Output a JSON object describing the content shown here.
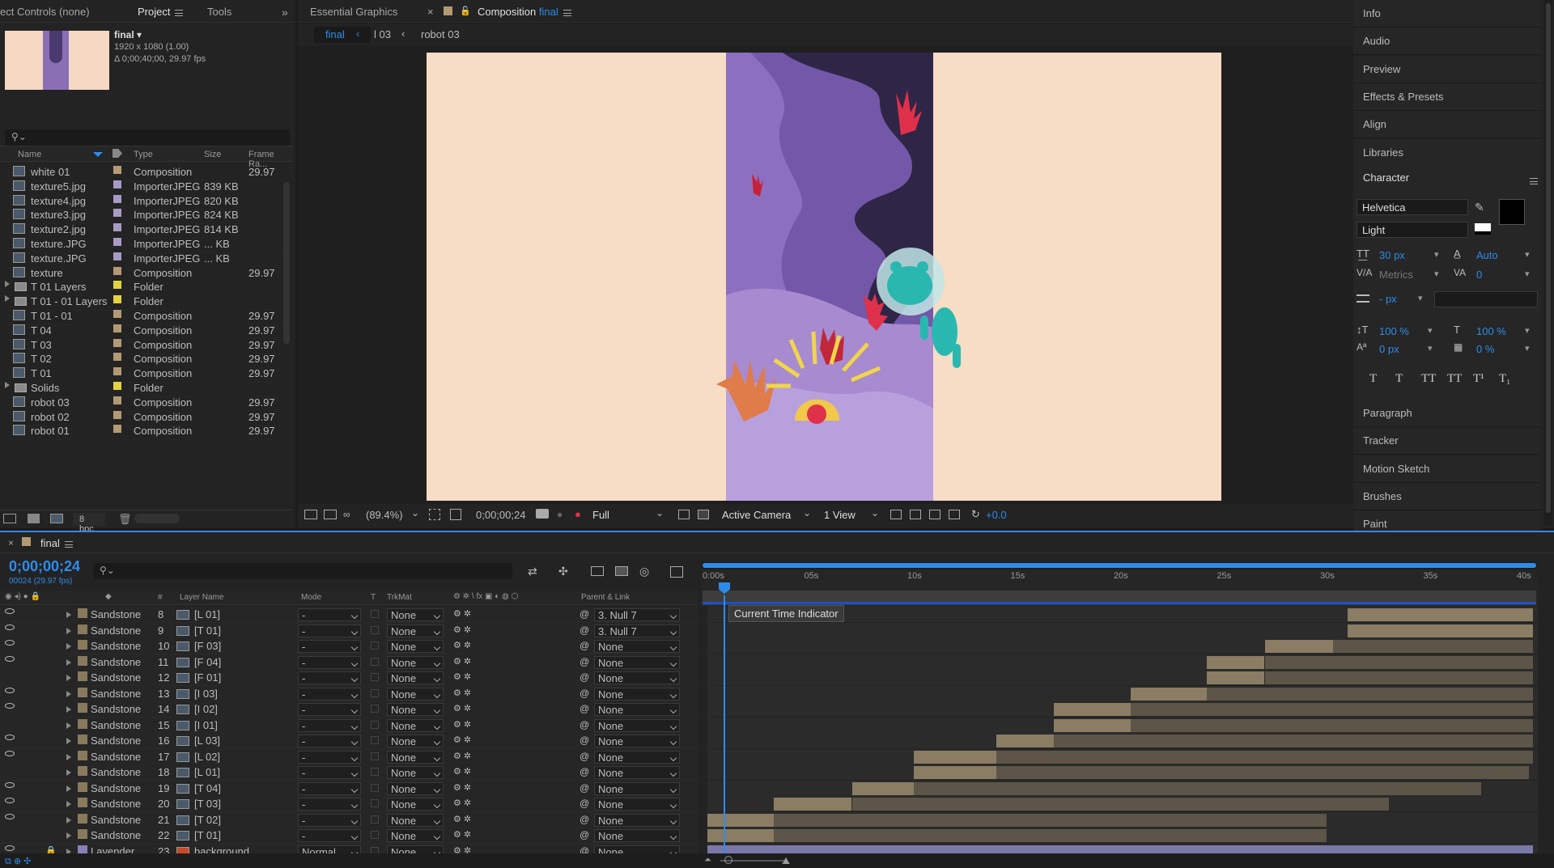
{
  "project_panel": {
    "tabs": [
      "ect Controls (none)",
      "Project",
      "Tools"
    ],
    "selected_name": "final",
    "selected_info": [
      "1920 x 1080 (1.00)",
      "Δ 0;00;40;00, 29.97 fps"
    ],
    "columns": [
      "Name",
      "Type",
      "Size",
      "Frame Ra..."
    ],
    "items": [
      {
        "name": "white 01",
        "type": "Composition",
        "size": "",
        "fps": "29.97",
        "kind": "comp",
        "label": "#b39a74"
      },
      {
        "name": "texture5.jpg",
        "type": "ImporterJPEG",
        "size": "839 KB",
        "fps": "",
        "kind": "file",
        "label": "#a89ac4"
      },
      {
        "name": "texture4.jpg",
        "type": "ImporterJPEG",
        "size": "820 KB",
        "fps": "",
        "kind": "file",
        "label": "#a89ac4"
      },
      {
        "name": "texture3.jpg",
        "type": "ImporterJPEG",
        "size": "824 KB",
        "fps": "",
        "kind": "file",
        "label": "#a89ac4"
      },
      {
        "name": "texture2.jpg",
        "type": "ImporterJPEG",
        "size": "814 KB",
        "fps": "",
        "kind": "file",
        "label": "#a89ac4"
      },
      {
        "name": "texture.JPG",
        "type": "ImporterJPEG",
        "size": "... KB",
        "fps": "",
        "kind": "file",
        "label": "#a89ac4"
      },
      {
        "name": "texture.JPG",
        "type": "ImporterJPEG",
        "size": "... KB",
        "fps": "",
        "kind": "file",
        "label": "#a89ac4"
      },
      {
        "name": "texture",
        "type": "Composition",
        "size": "",
        "fps": "29.97",
        "kind": "comp",
        "label": "#b39a74"
      },
      {
        "name": "T 01 Layers",
        "type": "Folder",
        "size": "",
        "fps": "",
        "kind": "folder",
        "label": "#e5d33d"
      },
      {
        "name": "T 01 - 01 Layers",
        "type": "Folder",
        "size": "",
        "fps": "",
        "kind": "folder",
        "label": "#e5d33d"
      },
      {
        "name": "T 01 - 01",
        "type": "Composition",
        "size": "",
        "fps": "29.97",
        "kind": "comp",
        "label": "#b39a74"
      },
      {
        "name": "T 04",
        "type": "Composition",
        "size": "",
        "fps": "29.97",
        "kind": "comp",
        "label": "#b39a74"
      },
      {
        "name": "T 03",
        "type": "Composition",
        "size": "",
        "fps": "29.97",
        "kind": "comp",
        "label": "#b39a74"
      },
      {
        "name": "T 02",
        "type": "Composition",
        "size": "",
        "fps": "29.97",
        "kind": "comp",
        "label": "#b39a74"
      },
      {
        "name": "T 01",
        "type": "Composition",
        "size": "",
        "fps": "29.97",
        "kind": "comp",
        "label": "#b39a74"
      },
      {
        "name": "Solids",
        "type": "Folder",
        "size": "",
        "fps": "",
        "kind": "folder",
        "label": "#e5d33d"
      },
      {
        "name": "robot 03",
        "type": "Composition",
        "size": "",
        "fps": "29.97",
        "kind": "comp",
        "label": "#b39a74"
      },
      {
        "name": "robot 02",
        "type": "Composition",
        "size": "",
        "fps": "29.97",
        "kind": "comp",
        "label": "#b39a74"
      },
      {
        "name": "robot 01",
        "type": "Composition",
        "size": "",
        "fps": "29.97",
        "kind": "comp",
        "label": "#b39a74"
      }
    ],
    "bpc": "8 bpc"
  },
  "viewer": {
    "tabs": [
      "Essential Graphics",
      "Composition",
      "final"
    ],
    "breadcrumbs": [
      "final",
      "l 03",
      "robot 03"
    ],
    "zoom": "(89.4%)",
    "timecode": "0;00;00;24",
    "resolution": "Full",
    "camera": "Active Camera",
    "views": "1 View",
    "exposure": "+0.0"
  },
  "right_panel": {
    "sections_top": [
      "Info",
      "Audio",
      "Preview",
      "Effects & Presets",
      "Align",
      "Libraries"
    ],
    "character_title": "Character",
    "font": "Helvetica",
    "style": "Light",
    "size": "30 px",
    "leading": "Auto",
    "kerning": "Metrics",
    "tracking": "0",
    "stroke": "- px",
    "vscale": "100 %",
    "hscale": "100 %",
    "baseline": "0 px",
    "tsume": "0 %",
    "type_buttons": [
      "T",
      "T",
      "TT",
      "TT",
      "T¹",
      "T₁"
    ],
    "sections_bottom": [
      "Paragraph",
      "Tracker",
      "Motion Sketch",
      "Brushes",
      "Paint"
    ]
  },
  "timeline": {
    "comp_name": "final",
    "timecode": "0;00;00;24",
    "frame_info": "00024 (29.97 fps)",
    "columns": [
      "Layer Name",
      "Mode",
      "T",
      "TrkMat",
      "Parent & Link"
    ],
    "ticks": [
      "0:00s",
      "05s",
      "10s",
      "15s",
      "20s",
      "25s",
      "30s",
      "35s",
      "40s"
    ],
    "tooltip": "Current Time Indicator",
    "layers": [
      {
        "color": "Sandstone",
        "num": "8",
        "name": "[L 01]",
        "mode": "-",
        "trk": "None",
        "parent": "3. Null 7",
        "eye": true,
        "bar": [
          31.0,
          40.0
        ],
        "lite": null
      },
      {
        "color": "Sandstone",
        "num": "9",
        "name": "[T 01]",
        "mode": "-",
        "trk": "None",
        "parent": "3. Null 7",
        "eye": true,
        "bar": [
          31.0,
          40.0
        ],
        "lite": null
      },
      {
        "color": "Sandstone",
        "num": "10",
        "name": "[F 03]",
        "mode": "-",
        "trk": "None",
        "parent": "None",
        "eye": true,
        "bar": [
          27.0,
          30.3
        ],
        "lite": [
          30.3,
          40.0
        ]
      },
      {
        "color": "Sandstone",
        "num": "11",
        "name": "[F 04]",
        "mode": "-",
        "trk": "None",
        "parent": "None",
        "eye": true,
        "bar": [
          24.2,
          27.0
        ],
        "lite": [
          27.0,
          40.0
        ]
      },
      {
        "color": "Sandstone",
        "num": "12",
        "name": "[F 01]",
        "mode": "-",
        "trk": "None",
        "parent": "None",
        "eye": false,
        "bar": [
          24.2,
          27.0
        ],
        "lite": [
          27.0,
          40.0
        ]
      },
      {
        "color": "Sandstone",
        "num": "13",
        "name": "[I 03]",
        "mode": "-",
        "trk": "None",
        "parent": "None",
        "eye": true,
        "bar": [
          20.5,
          24.2
        ],
        "lite": [
          24.2,
          40.0
        ]
      },
      {
        "color": "Sandstone",
        "num": "14",
        "name": "[I 02]",
        "mode": "-",
        "trk": "None",
        "parent": "None",
        "eye": true,
        "bar": [
          16.8,
          20.5
        ],
        "lite": [
          20.5,
          40.0
        ]
      },
      {
        "color": "Sandstone",
        "num": "15",
        "name": "[I 01]",
        "mode": "-",
        "trk": "None",
        "parent": "None",
        "eye": false,
        "bar": [
          16.8,
          20.5
        ],
        "lite": [
          20.5,
          40.0
        ]
      },
      {
        "color": "Sandstone",
        "num": "16",
        "name": "[L 03]",
        "mode": "-",
        "trk": "None",
        "parent": "None",
        "eye": true,
        "bar": [
          14.0,
          16.8
        ],
        "lite": [
          16.8,
          40.0
        ]
      },
      {
        "color": "Sandstone",
        "num": "17",
        "name": "[L 02]",
        "mode": "-",
        "trk": "None",
        "parent": "None",
        "eye": true,
        "bar": [
          10.0,
          14.0
        ],
        "lite": [
          14.0,
          40.0
        ]
      },
      {
        "color": "Sandstone",
        "num": "18",
        "name": "[L 01]",
        "mode": "-",
        "trk": "None",
        "parent": "None",
        "eye": false,
        "bar": [
          10.0,
          14.0
        ],
        "lite": [
          14.0,
          39.8
        ]
      },
      {
        "color": "Sandstone",
        "num": "19",
        "name": "[T 04]",
        "mode": "-",
        "trk": "None",
        "parent": "None",
        "eye": true,
        "bar": [
          7.0,
          10.0
        ],
        "lite": [
          10.0,
          37.5
        ]
      },
      {
        "color": "Sandstone",
        "num": "20",
        "name": "[T 03]",
        "mode": "-",
        "trk": "None",
        "parent": "None",
        "eye": true,
        "bar": [
          3.2,
          7.0
        ],
        "lite": [
          7.0,
          33.0
        ]
      },
      {
        "color": "Sandstone",
        "num": "21",
        "name": "[T 02]",
        "mode": "-",
        "trk": "None",
        "parent": "None",
        "eye": true,
        "bar": [
          0.0,
          3.2
        ],
        "lite": [
          3.2,
          30.0
        ]
      },
      {
        "color": "Sandstone",
        "num": "22",
        "name": "[T 01]",
        "mode": "-",
        "trk": "None",
        "parent": "None",
        "eye": false,
        "bar": [
          0.0,
          3.2
        ],
        "lite": [
          3.2,
          30.0
        ]
      },
      {
        "color": "Lavender",
        "num": "23",
        "name": "background",
        "mode": "Normal",
        "trk": "None",
        "parent": "None",
        "eye": true,
        "bar": null,
        "lite": [
          0.0,
          40.0
        ]
      }
    ]
  }
}
